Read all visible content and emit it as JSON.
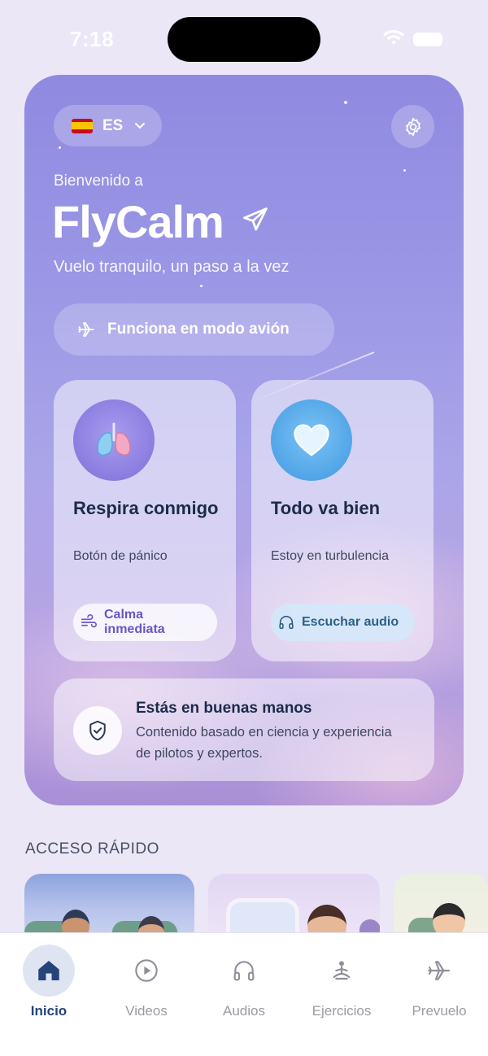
{
  "status_bar": {
    "time": "7:18"
  },
  "hero": {
    "language": {
      "flag": "spain-flag",
      "code": "ES"
    },
    "welcome": "Bienvenido a",
    "brand": "FlyCalm",
    "tagline": "Vuelo tranquilo, un paso a la vez",
    "offline_label": "Funciona en modo avión",
    "cards": [
      {
        "icon": "lungs-icon",
        "title": "Respira conmigo",
        "subtitle": "Botón de pánico",
        "button_icon": "wind-icon",
        "button_label": "Calma inmediata"
      },
      {
        "icon": "heart-icon",
        "title": "Todo va bien",
        "subtitle": "Estoy en turbulencia",
        "button_icon": "headphones-icon",
        "button_label": "Escuchar audio"
      }
    ],
    "trust": {
      "icon": "shield-check-icon",
      "title": "Estás en buenas manos",
      "text": "Contenido basado en ciencia y experiencia de pilotos y expertos."
    }
  },
  "quick_access": {
    "title": "ACCESO RÁPIDO"
  },
  "tabbar": {
    "items": [
      {
        "label": "Inicio",
        "icon": "home-icon",
        "active": true
      },
      {
        "label": "Videos",
        "icon": "play-circle-icon",
        "active": false
      },
      {
        "label": "Audios",
        "icon": "headphones-icon",
        "active": false
      },
      {
        "label": "Ejercicios",
        "icon": "meditation-icon",
        "active": false
      },
      {
        "label": "Prevuelo",
        "icon": "airplane-icon",
        "active": false
      }
    ]
  },
  "colors": {
    "accent_purple": "#6a55c4",
    "accent_blue": "#2d5f86",
    "active_tab": "#25447a",
    "background": "#ebe7f7"
  }
}
